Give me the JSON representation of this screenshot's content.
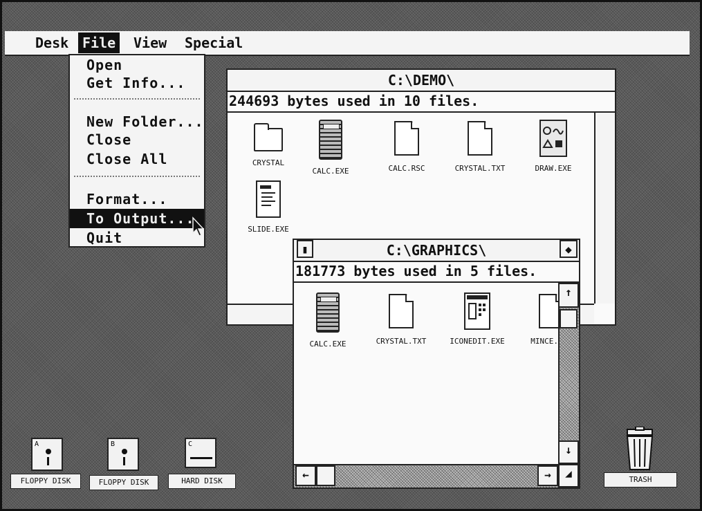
{
  "menubar": {
    "items": [
      {
        "label": "Desk"
      },
      {
        "label": "File"
      },
      {
        "label": "View"
      },
      {
        "label": "Special"
      }
    ]
  },
  "file_menu": {
    "items": [
      {
        "label": "Open"
      },
      {
        "label": "Get Info..."
      },
      {
        "label": "New Folder..."
      },
      {
        "label": "Close"
      },
      {
        "label": "Close All"
      },
      {
        "label": "Format..."
      },
      {
        "label": "To Output..."
      },
      {
        "label": "Quit"
      }
    ]
  },
  "demo_window": {
    "title": "C:\\DEMO\\",
    "info": "244693 bytes used in 10 files.",
    "icons": [
      {
        "label": "CRYSTAL",
        "icon": "folder-icon"
      },
      {
        "label": "CALC.EXE",
        "icon": "calculator-icon"
      },
      {
        "label": "CALC.RSC",
        "icon": "document-icon"
      },
      {
        "label": "CRYSTAL.TXT",
        "icon": "document-icon"
      },
      {
        "label": "DRAW.EXE",
        "icon": "draw-program-icon"
      },
      {
        "label": "SLIDE.EXE",
        "icon": "slide-program-icon"
      }
    ]
  },
  "graphics_window": {
    "title": "C:\\GRAPHICS\\",
    "info": "181773 bytes used in 5 files.",
    "icons": [
      {
        "label": "CALC.EXE",
        "icon": "calculator-icon"
      },
      {
        "label": "CRYSTAL.TXT",
        "icon": "document-icon"
      },
      {
        "label": "ICONEDIT.EXE",
        "icon": "iconedit-program-icon"
      },
      {
        "label": "MINCE.",
        "icon": "document-icon"
      }
    ]
  },
  "desktop": {
    "drives": [
      {
        "label": "FLOPPY DISK",
        "letter": "A"
      },
      {
        "label": "FLOPPY DISK",
        "letter": "B"
      },
      {
        "label": "HARD DISK",
        "letter": "C"
      }
    ],
    "trash": {
      "label": "TRASH"
    }
  }
}
